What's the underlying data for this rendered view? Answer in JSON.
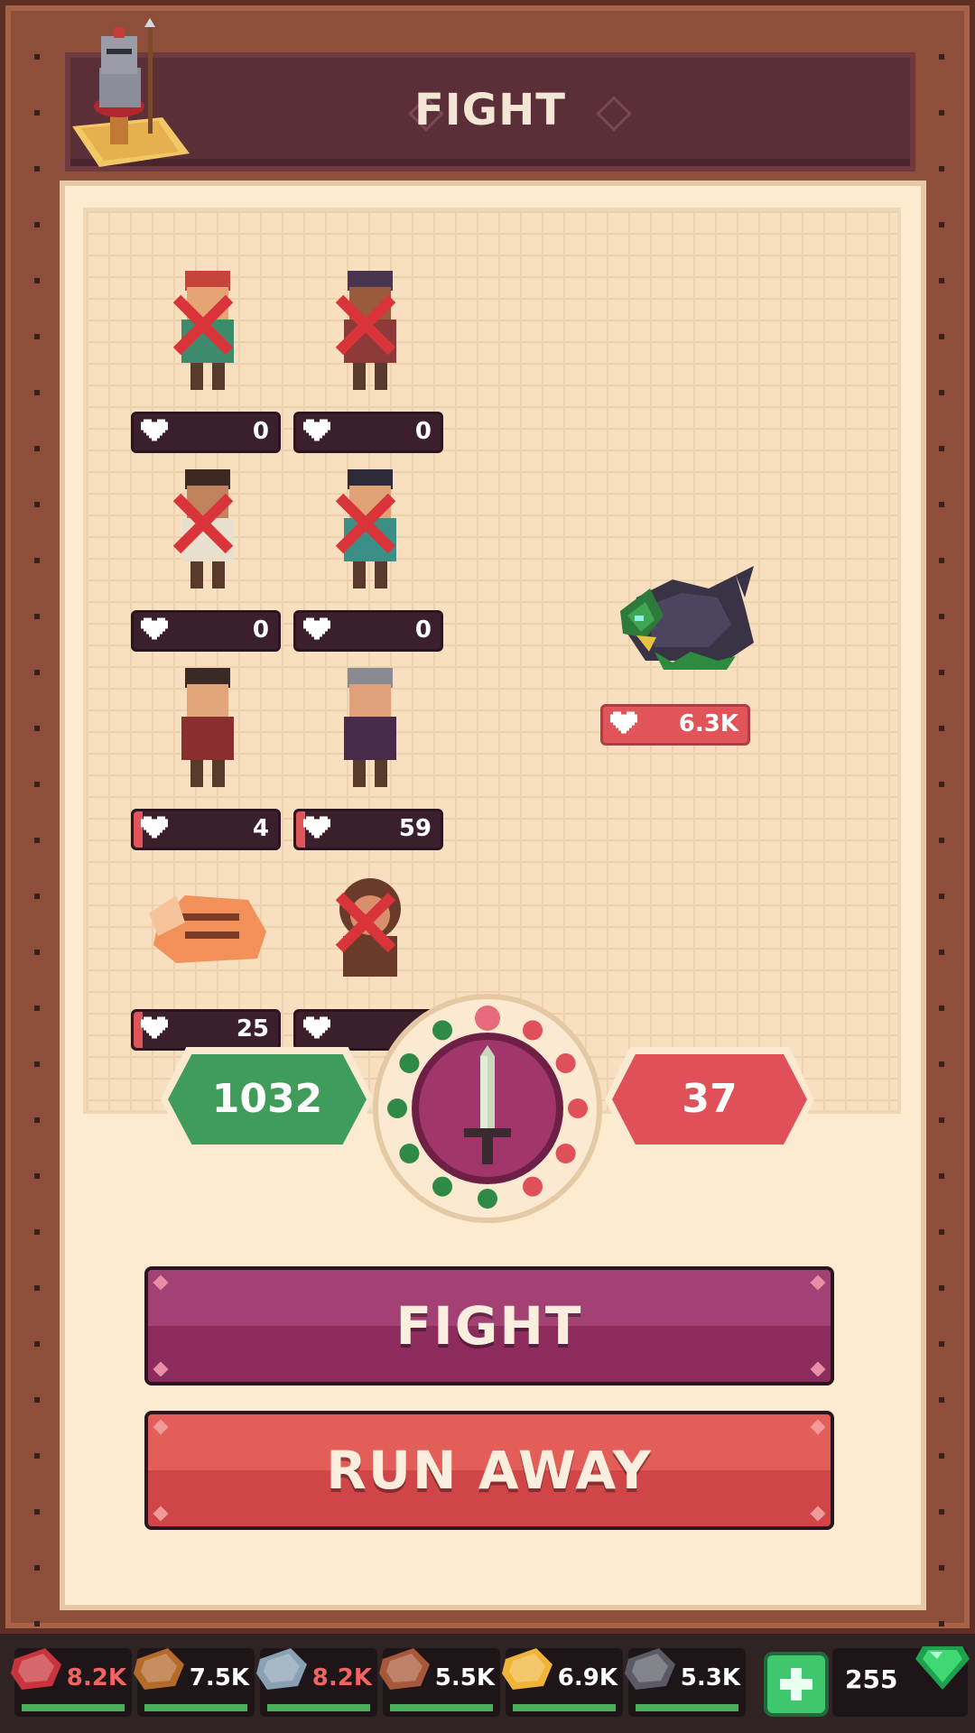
{
  "header": {
    "title": "FIGHT"
  },
  "party": [
    {
      "hp": "0",
      "defeated": true
    },
    {
      "hp": "0",
      "defeated": true
    },
    {
      "hp": "0",
      "defeated": true
    },
    {
      "hp": "0",
      "defeated": true
    },
    {
      "hp": "4",
      "defeated": false
    },
    {
      "hp": "59",
      "defeated": false
    },
    {
      "hp": "25",
      "defeated": false
    },
    {
      "hp": "",
      "defeated": true
    }
  ],
  "enemy": {
    "hp": "6.3K"
  },
  "battle": {
    "player_power": "1032",
    "enemy_power": "37"
  },
  "buttons": {
    "fight": "FIGHT",
    "run_away": "RUN AWAY"
  },
  "resources": [
    {
      "icon": "meat-icon",
      "value": "8.2K",
      "red": true
    },
    {
      "icon": "wood-log-icon",
      "value": "7.5K",
      "red": false
    },
    {
      "icon": "iron-ingot-icon",
      "value": "8.2K",
      "red": true
    },
    {
      "icon": "leather-icon",
      "value": "5.5K",
      "red": false
    },
    {
      "icon": "gold-nugget-icon",
      "value": "6.9K",
      "red": false
    },
    {
      "icon": "coal-icon",
      "value": "5.3K",
      "red": false
    }
  ],
  "gems": {
    "icon": "emerald-gem-icon",
    "value": "255"
  },
  "colors": {
    "player": "#3f9c5a",
    "enemy": "#e05058",
    "fight_button": "#8d2c5c",
    "run_button": "#d14648"
  }
}
